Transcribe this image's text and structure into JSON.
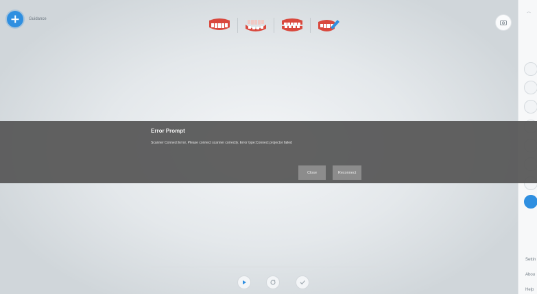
{
  "header": {
    "guidance_label": "Guidance"
  },
  "scan_modes": [
    {
      "name": "upper-jaw-scan",
      "icon": "teeth-upper-icon"
    },
    {
      "name": "lower-jaw-scan",
      "icon": "teeth-lower-icon"
    },
    {
      "name": "bite-scan",
      "icon": "teeth-bite-icon"
    },
    {
      "name": "edit",
      "icon": "teeth-edit-icon"
    }
  ],
  "error_prompt": {
    "title": "Error Prompt",
    "message": "Scanner Connect Error, Please connect scanner correctly. Error type:Connect projector failed",
    "close_label": "Close",
    "reconnect_label": "Reconnect"
  },
  "sidebar": {
    "settings_label": "Settin",
    "about_label": "Abou",
    "help_label": "Help"
  },
  "colors": {
    "accent": "#2f8fe0",
    "overlay": "#585858",
    "button": "#8c8c8c",
    "tooth_red": "#d9493e"
  }
}
